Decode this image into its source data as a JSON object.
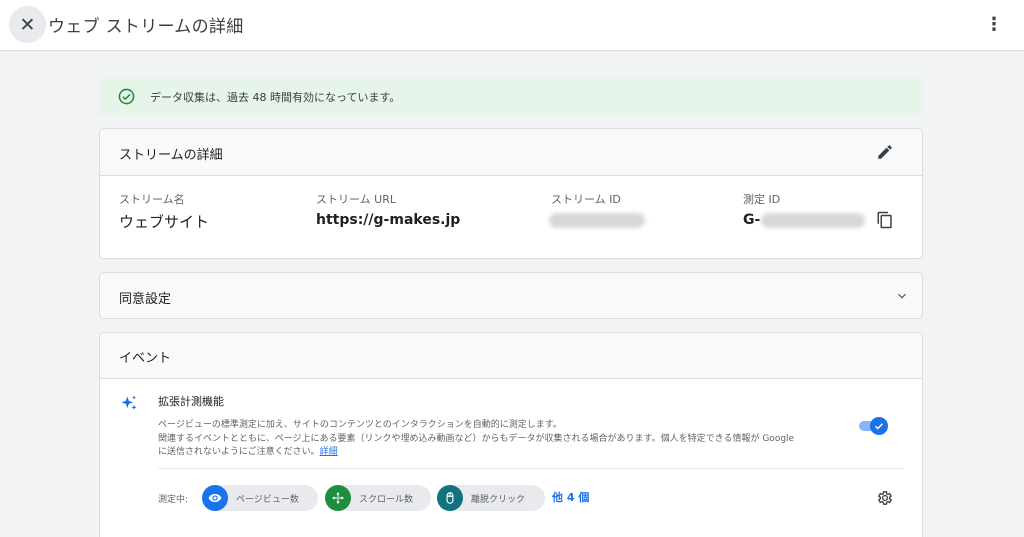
{
  "header": {
    "close_icon": "close-icon",
    "title": "ウェブ ストリームの詳細",
    "more_icon": "more-vert-icon"
  },
  "banner": {
    "icon": "check-circle-icon",
    "text": "データ収集は、過去 48 時間有効になっています。",
    "color": "#e6f4ea",
    "icon_color": "#1e8e3e"
  },
  "stream_details": {
    "title": "ストリームの詳細",
    "edit_icon": "edit-pencil-icon",
    "fields": [
      {
        "label": "ストリーム名",
        "value": "ウェブサイト"
      },
      {
        "label": "ストリーム URL",
        "value": "https://g-makes.jp"
      },
      {
        "label": "ストリーム ID",
        "value": ""
      },
      {
        "label": "測定 ID",
        "value": "G-"
      }
    ],
    "copy_icon": "copy-icon"
  },
  "consent": {
    "title": "同意設定",
    "icon": "chevron-down-icon"
  },
  "events": {
    "title": "イベント",
    "enhanced": {
      "icon": "sparkle-icon",
      "title": "拡張計測機能",
      "description_line1": "ページビューの標準測定に加え、サイトのコンテンツとのインタラクションを自動的に測定します。",
      "description_line2": "関連するイベントとともに、ページ上にある要素（リンクや埋め込み動画など）からもデータが収集される場合があります。個人を特定できる情報が Google",
      "description_line3": "に送信されないようにご注意ください。",
      "link": "詳細",
      "toggle_on": true
    },
    "measuring_label": "測定中:",
    "chips": [
      {
        "label": "ページビュー数",
        "icon": "eye-icon",
        "color": "#1a73e8"
      },
      {
        "label": "スクロール数",
        "icon": "scroll-arrows-icon",
        "color": "#1e8e3e"
      },
      {
        "label": "離脱クリック",
        "icon": "mouse-icon",
        "color": "#12737e"
      }
    ],
    "more": "他 4 個",
    "settings_icon": "gear-icon"
  },
  "accent_color": "#1a73e8"
}
